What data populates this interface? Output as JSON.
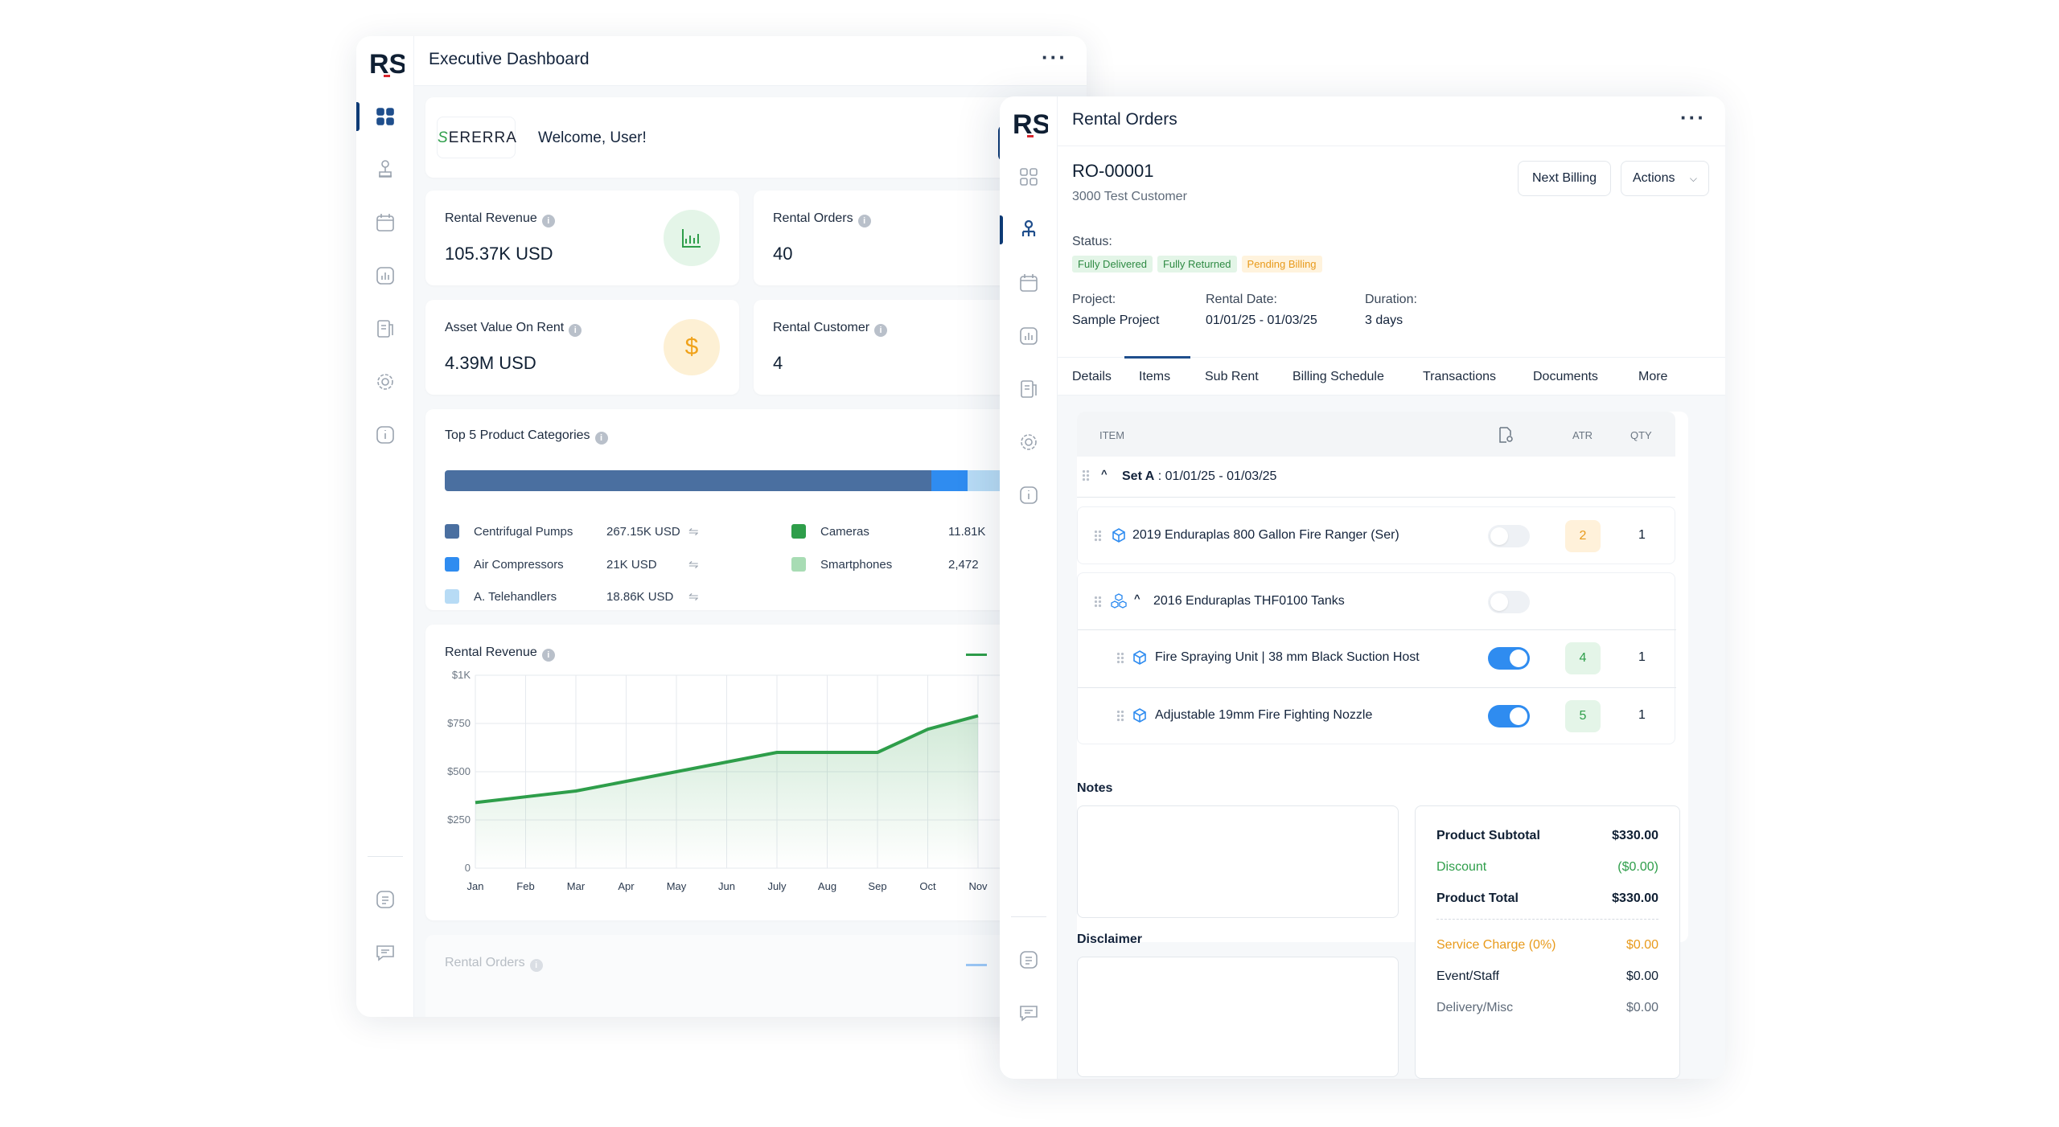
{
  "dashboard": {
    "title": "Executive Dashboard",
    "brand": "ERERRA",
    "brand_initial": "S",
    "welcome": "Welcome, User!",
    "kpis": [
      {
        "label": "Rental Revenue",
        "value": "105.37K USD",
        "icon": "chart-icon"
      },
      {
        "label": "Rental Orders",
        "value": "40",
        "icon": "orders-icon"
      },
      {
        "label": "Asset Value On Rent",
        "value": "4.39M USD",
        "icon": "dollar-icon"
      },
      {
        "label": "Rental Customer",
        "value": "4",
        "icon": "customer-icon"
      }
    ],
    "top_categories": {
      "title": "Top 5 Product Categories",
      "items": [
        {
          "name": "Centrifugal Pumps",
          "value": "267.15K USD",
          "color": "#4a6fa0"
        },
        {
          "name": "Air Compressors",
          "value": "21K USD",
          "color": "#2f8cf0"
        },
        {
          "name": "A. Telehandlers",
          "value": "18.86K USD",
          "color": "#b7dbf5"
        },
        {
          "name": "Cameras",
          "value": "11.81K",
          "color": "#2e9e4a"
        },
        {
          "name": "Smartphones",
          "value": "2,472",
          "color": "#a8dcb4"
        }
      ]
    },
    "revenue_chart_title": "Rental Revenue",
    "orders_chart_title": "Rental Orders"
  },
  "chart_data": {
    "type": "area",
    "title": "Rental Revenue",
    "categories": [
      "Jan",
      "Feb",
      "Mar",
      "Apr",
      "May",
      "Jun",
      "July",
      "Aug",
      "Sep",
      "Oct",
      "Nov"
    ],
    "values": [
      340,
      370,
      400,
      450,
      500,
      550,
      600,
      600,
      600,
      720,
      790
    ],
    "yticks": [
      "$1K",
      "$750",
      "$500",
      "$250",
      "0"
    ],
    "ylim": [
      0,
      1000
    ],
    "grid": true,
    "color": "#2e9e4a"
  },
  "rental": {
    "title": "Rental Orders",
    "order_id": "RO-00001",
    "customer": "3000 Test Customer",
    "next_billing": "Next Billing",
    "actions": "Actions",
    "status_label": "Status:",
    "statuses": [
      {
        "text": "Fully Delivered",
        "bg": "#e3f5e7",
        "fg": "#2e8a43"
      },
      {
        "text": "Fully Returned",
        "bg": "#e3f5e7",
        "fg": "#2e8a43"
      },
      {
        "text": "Pending Billing",
        "bg": "#fff3dd",
        "fg": "#e89a1b"
      }
    ],
    "project_label": "Project:",
    "project": "Sample Project",
    "date_label": "Rental Date:",
    "date": "01/01/25 - 01/03/25",
    "duration_label": "Duration:",
    "duration": "3 days",
    "tabs": [
      "Details",
      "Items",
      "Sub Rent",
      "Billing Schedule",
      "Transactions",
      "Documents",
      "More"
    ],
    "columns": {
      "item": "ITEM",
      "atr": "ATR",
      "qty": "QTY"
    },
    "set_label": "Set A",
    "set_range": ": 01/01/25 - 01/03/25",
    "items": [
      {
        "name": "2019 Enduraplas 800 Gallon Fire Ranger (Ser)",
        "atr": "2",
        "qty": "1"
      },
      {
        "name": "2016 Enduraplas THF0100 Tanks"
      },
      {
        "name": "Fire Spraying Unit | 38 mm Black Suction Host",
        "atr": "4",
        "qty": "1"
      },
      {
        "name": "Adjustable 19mm Fire Fighting Nozzle",
        "atr": "5",
        "qty": "1"
      }
    ],
    "notes_label": "Notes",
    "disclaimer_label": "Disclaimer",
    "summary": [
      {
        "label": "Product Subtotal",
        "value": "$330.00"
      },
      {
        "label": "Discount",
        "value": "($0.00)"
      },
      {
        "label": "Product Total",
        "value": "$330.00"
      },
      {
        "label": "Service Charge (0%)",
        "value": "$0.00"
      },
      {
        "label": "Event/Staff",
        "value": "$0.00"
      },
      {
        "label": "Delivery/Misc",
        "value": "$0.00"
      }
    ]
  }
}
